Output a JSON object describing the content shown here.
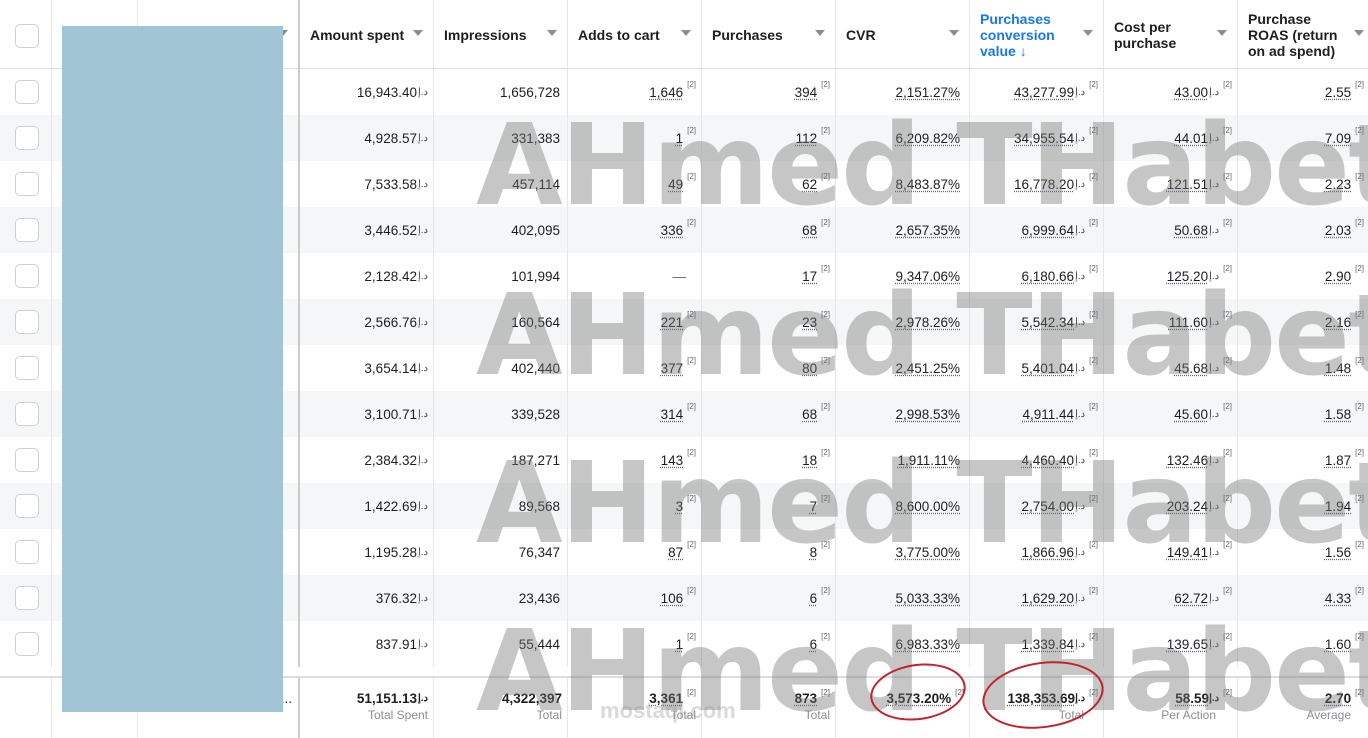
{
  "columns": {
    "amount_spent": "Amount spent",
    "impressions": "Impressions",
    "adds_to_cart": "Adds to cart",
    "purchases": "Purchases",
    "cvr": "CVR",
    "pcv_line1": "Purchases",
    "pcv_line2": "conversion",
    "pcv_line3": "value",
    "pcv_arrow": "↓",
    "cpp_line1": "Cost per",
    "cpp_line2": "purchase",
    "roas_line1": "Purchase",
    "roas_line2": "ROAS (return",
    "roas_line3": "on ad spend)"
  },
  "currency": "د.إ",
  "ref_mark": "[2]",
  "rows": [
    {
      "spent": "16,943.40",
      "impr": "1,656,728",
      "atc": "1,646",
      "purch": "394",
      "cvr": "2,151.27%",
      "pcv": "43,277.99",
      "cpp": "43.00",
      "roas": "2.55"
    },
    {
      "spent": "4,928.57",
      "impr": "331,383",
      "atc": "1",
      "purch": "112",
      "cvr": "6,209.82%",
      "pcv": "34,955.54",
      "cpp": "44.01",
      "roas": "7.09"
    },
    {
      "spent": "7,533.58",
      "impr": "457,114",
      "atc": "49",
      "purch": "62",
      "cvr": "8,483.87%",
      "pcv": "16,778.20",
      "cpp": "121.51",
      "roas": "2.23"
    },
    {
      "spent": "3,446.52",
      "impr": "402,095",
      "atc": "336",
      "purch": "68",
      "cvr": "2,657.35%",
      "pcv": "6,999.64",
      "cpp": "50.68",
      "roas": "2.03"
    },
    {
      "spent": "2,128.42",
      "impr": "101,994",
      "atc": "—",
      "purch": "17",
      "cvr": "9,347.06%",
      "pcv": "6,180.66",
      "cpp": "125.20",
      "roas": "2.90"
    },
    {
      "spent": "2,566.76",
      "impr": "160,564",
      "atc": "221",
      "purch": "23",
      "cvr": "2,978.26%",
      "pcv": "5,542.34",
      "cpp": "111.60",
      "roas": "2.16"
    },
    {
      "spent": "3,654.14",
      "impr": "402,440",
      "atc": "377",
      "purch": "80",
      "cvr": "2,451.25%",
      "pcv": "5,401.04",
      "cpp": "45.68",
      "roas": "1.48"
    },
    {
      "spent": "3,100.71",
      "impr": "339,528",
      "atc": "314",
      "purch": "68",
      "cvr": "2,998.53%",
      "pcv": "4,911.44",
      "cpp": "45.60",
      "roas": "1.58"
    },
    {
      "spent": "2,384.32",
      "impr": "187,271",
      "atc": "143",
      "purch": "18",
      "cvr": "1,911.11%",
      "pcv": "4,460.40",
      "cpp": "132.46",
      "roas": "1.87"
    },
    {
      "spent": "1,422.69",
      "impr": "89,568",
      "atc": "3",
      "purch": "7",
      "cvr": "8,600.00%",
      "pcv": "2,754.00",
      "cpp": "203.24",
      "roas": "1.94"
    },
    {
      "spent": "1,195.28",
      "impr": "76,347",
      "atc": "87",
      "purch": "8",
      "cvr": "3,775.00%",
      "pcv": "1,866.96",
      "cpp": "149.41",
      "roas": "1.56"
    },
    {
      "spent": "376.32",
      "impr": "23,436",
      "atc": "106",
      "purch": "6",
      "cvr": "5,033.33%",
      "pcv": "1,629.20",
      "cpp": "62.72",
      "roas": "4.33"
    },
    {
      "spent": "837.91",
      "impr": "55,444",
      "atc": "1",
      "purch": "6",
      "cvr": "6,983.33%",
      "pcv": "1,339.84",
      "cpp": "139.65",
      "roas": "1.60"
    }
  ],
  "totals": {
    "spent": "51,151.13",
    "spent_label": "Total Spent",
    "impr": "4,322,397",
    "impr_label": "Total",
    "atc": "3,361",
    "atc_label": "Total",
    "purch": "873",
    "purch_label": "Total",
    "cvr": "3,573.20%",
    "pcv": "138,353.69",
    "pcv_label": "Total",
    "cpp": "58.59",
    "cpp_label": "Per Action",
    "roas": "2.70",
    "roas_label": "Average",
    "ellipsis": "..."
  },
  "watermark": "AHmed THabet",
  "watermark2": "mostaql.com"
}
